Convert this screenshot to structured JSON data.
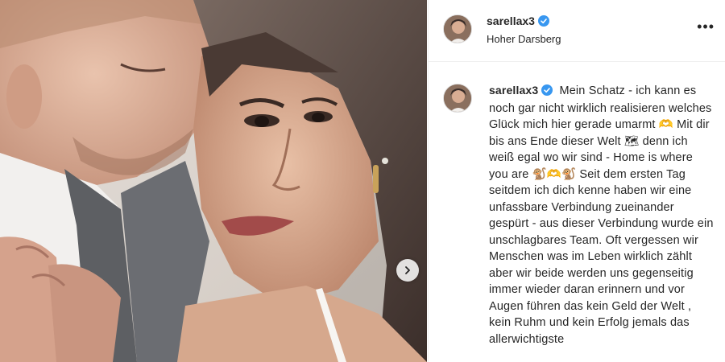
{
  "post": {
    "image_alt": "Couple embracing, woman looking at camera",
    "next_icon": "chevron-right-icon"
  },
  "header": {
    "username": "sarellax3",
    "location": "Hoher Darsberg",
    "more_icon": "more-horizontal-icon",
    "more_label": "•••"
  },
  "caption": {
    "username": "sarellax3",
    "text": "Mein Schatz - ich kann es noch gar nicht wirklich realisieren welches Glück mich hier gerade umarmt 🫶 Mit dir bis ans Ende dieser Welt 🗺 denn ich weiß egal wo wir sind - Home is where you are 🐒🫶🐒 Seit dem ersten Tag seitdem ich dich kenne haben wir eine unfassbare Verbindung zueinander gespürt - aus dieser Verbindung wurde ein unschlagbares Team. Oft vergessen wir Menschen was im Leben wirklich zählt aber wir beide werden uns gegenseitig immer wieder daran erinnern und vor Augen führen das kein Geld der Welt , kein Ruhm und kein Erfolg jemals das allerwichtigste"
  },
  "colors": {
    "verified": "#3897f0",
    "text": "#262626",
    "border": "#efefef"
  }
}
